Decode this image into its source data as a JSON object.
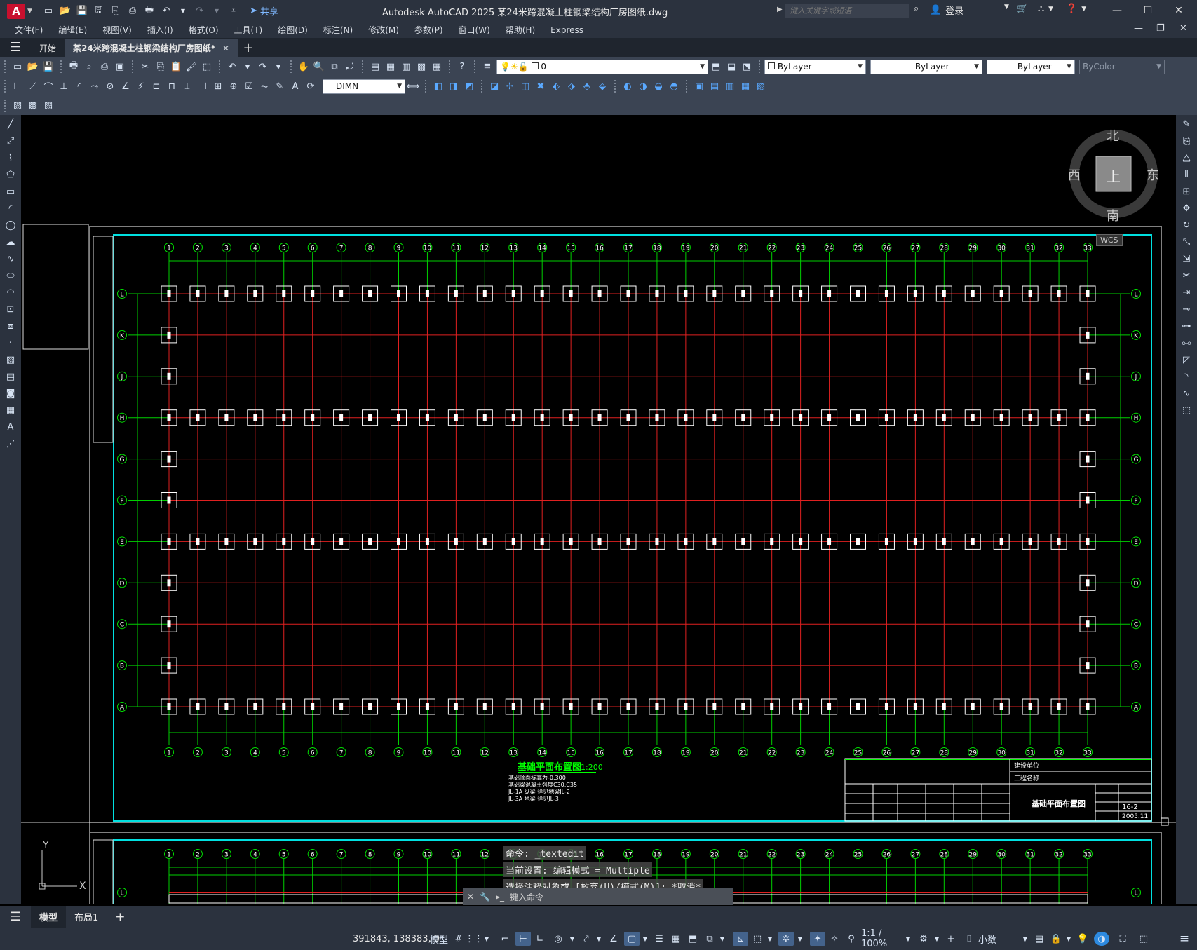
{
  "app": {
    "logo": "A",
    "share_label": "共享",
    "title": "Autodesk AutoCAD 2025    某24米跨混凝土柱钢梁结构厂房图纸.dwg",
    "search_placeholder": "键入关键字或短语",
    "login_label": "登录"
  },
  "menu": [
    "文件(F)",
    "编辑(E)",
    "视图(V)",
    "插入(I)",
    "格式(O)",
    "工具(T)",
    "绘图(D)",
    "标注(N)",
    "修改(M)",
    "参数(P)",
    "窗口(W)",
    "帮助(H)",
    "Express"
  ],
  "tabs": {
    "start": "开始",
    "file": "某24米跨混凝土柱钢梁结构厂房图纸*"
  },
  "toolbar": {
    "layer": "0",
    "color": "ByLayer",
    "linetype": "ByLayer",
    "lineweight": "ByLayer",
    "plotstyle": "ByColor",
    "dimstyle": "DIMN"
  },
  "compass": {
    "north": "北",
    "south": "南",
    "east": "东",
    "west": "西",
    "top": "上",
    "wcs": "WCS"
  },
  "drawing": {
    "grid_cols": [
      "1",
      "2",
      "3",
      "4",
      "5",
      "6",
      "7",
      "8",
      "9",
      "10",
      "11",
      "12",
      "13",
      "14",
      "15",
      "16",
      "17",
      "18",
      "19",
      "20",
      "21",
      "22",
      "23",
      "24",
      "25",
      "26",
      "27",
      "28",
      "29",
      "30",
      "31",
      "32",
      "33"
    ],
    "grid_rows": [
      "L",
      "K",
      "J",
      "H",
      "G",
      "F",
      "E",
      "D",
      "C",
      "B",
      "A"
    ],
    "plan_title": "基础平面布置图",
    "plan_scale": "1:200",
    "note_lines": [
      "基础顶面标高为-0.300",
      "基础梁混凝土强度C30,C35",
      "JL-1A 纵梁 详见地梁JL-2",
      "JL-3A 地梁 详见JL-3"
    ],
    "title_block": {
      "drawing_name": "基础平面布置图",
      "sheet_no": "16-2",
      "date": "2005.11",
      "company": "建设单位",
      "project": "工程名称"
    },
    "ucs_y": "Y",
    "ucs_x": "X"
  },
  "command": {
    "line1": "命令: _textedit",
    "line2": "当前设置: 编辑模式 = Multiple",
    "line3": "选择注释对象或 [放弃(U)/模式(M)]: *取消*",
    "prompt": "键入命令"
  },
  "layouts": [
    "模型",
    "布局1"
  ],
  "status": {
    "coords": "391843, 138383, 0",
    "model_label": "模型",
    "scale": "1:1 / 100%",
    "units": "小数"
  }
}
